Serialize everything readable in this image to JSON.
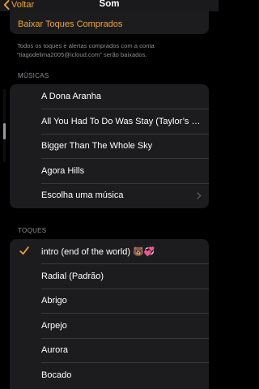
{
  "nav": {
    "back_label": "Voltar",
    "title": "Som"
  },
  "download": {
    "label": "Baixar Toques Comprados",
    "note": "Todos os toques e alertas comprados com a conta “tiagodelima2005@icloud.com” serão baixados."
  },
  "music_section": {
    "header": "MÚSICAS",
    "items": [
      {
        "label": "A Dona Aranha"
      },
      {
        "label": "All You Had To Do Was Stay (Taylor’s Version)"
      },
      {
        "label": "Bigger Than The Whole Sky"
      },
      {
        "label": "Agora Hills"
      },
      {
        "label": "Escolha uma música"
      }
    ]
  },
  "tones_section": {
    "header": "TOQUES",
    "items": [
      {
        "label": "intro (end of the world) 🐻💞",
        "selected": true
      },
      {
        "label": "Radial (Padrão)"
      },
      {
        "label": "Abrigo"
      },
      {
        "label": "Arpejo"
      },
      {
        "label": "Aurora"
      },
      {
        "label": "Bocado"
      }
    ]
  },
  "colors": {
    "accent": "#f3a52f",
    "background": "#000000",
    "cell": "#1c1c1e"
  }
}
